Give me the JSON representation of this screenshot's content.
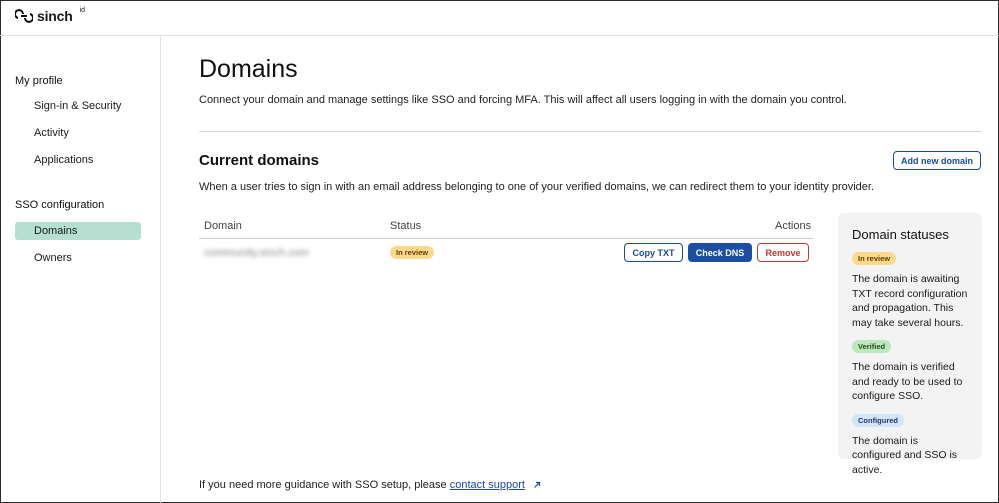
{
  "app": {
    "brand": "sinch",
    "brand_sup": "id"
  },
  "sidebar": {
    "groups": [
      {
        "label": "My profile",
        "items": [
          {
            "label": "Sign-in & Security"
          },
          {
            "label": "Activity"
          },
          {
            "label": "Applications"
          }
        ]
      },
      {
        "label": "SSO configuration",
        "items": [
          {
            "label": "Domains",
            "active": true
          },
          {
            "label": "Owners"
          }
        ]
      }
    ]
  },
  "main": {
    "title": "Domains",
    "description": "Connect your domain and manage settings like SSO and forcing MFA. This will affect all users logging in with the domain you control.",
    "section_title": "Current domains",
    "add_button": "Add new domain",
    "section_description": "When a user tries to sign in with an email address belonging to one of your verified domains, we can redirect them to your identity provider.",
    "table": {
      "columns": [
        "Domain",
        "Status",
        "Actions"
      ],
      "rows": [
        {
          "domain": "community.sinch.com",
          "status": "In review",
          "actions": [
            "Copy TXT",
            "Check DNS",
            "Remove"
          ]
        }
      ]
    },
    "statuses": {
      "title": "Domain statuses",
      "items": [
        {
          "badge": "In review",
          "text": "The domain is awaiting TXT record configuration and propagation. This may take several hours."
        },
        {
          "badge": "Verified",
          "text": "The domain is verified and ready to be used to configure SSO."
        },
        {
          "badge": "Configured",
          "text": "The domain is configured and SSO is active."
        }
      ]
    },
    "footer": {
      "text": "If you need more guidance with SSO setup, please",
      "link": "contact support"
    }
  },
  "colors": {
    "accent": "#1a4ea0",
    "active_nav": "#b5dfd0",
    "danger": "#c0392b",
    "badge_review": "#ffd98a",
    "badge_verified": "#bde8bd",
    "badge_configured": "#d3e5fb"
  }
}
